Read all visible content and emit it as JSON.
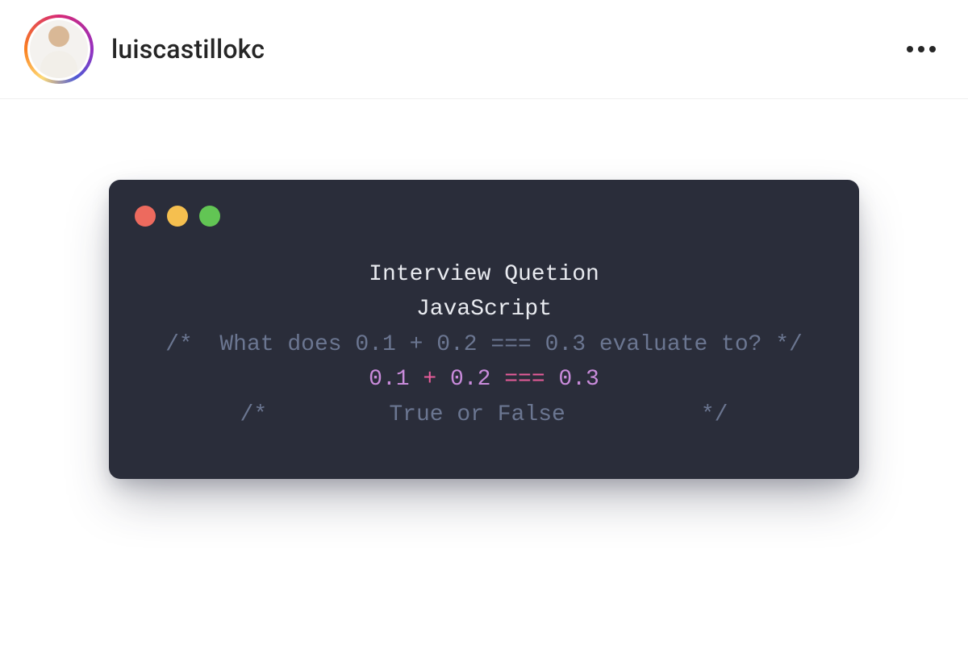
{
  "header": {
    "username": "luiscastillokc"
  },
  "colors": {
    "window_bg": "#2a2d3a",
    "traffic_red": "#ed6a5e",
    "traffic_yellow": "#f5bf4f",
    "traffic_green": "#62c554",
    "comment": "#6b7691",
    "text": "#e9ebf0",
    "number": "#c98bdb",
    "operator": "#e85d9b"
  },
  "code": {
    "title_line_1": "Interview Quetion",
    "title_line_2": "JavaScript",
    "comment_open_1": "/*  ",
    "question": "What does 0.1 + 0.2 === 0.3 evaluate to?",
    "comment_close_1": " */",
    "expr_n1": "0.1",
    "expr_plus": " + ",
    "expr_n2": "0.2",
    "expr_eq": " === ",
    "expr_n3": "0.3",
    "comment_open_2": "/*         ",
    "tf": "True or False",
    "comment_close_2": "          */"
  }
}
